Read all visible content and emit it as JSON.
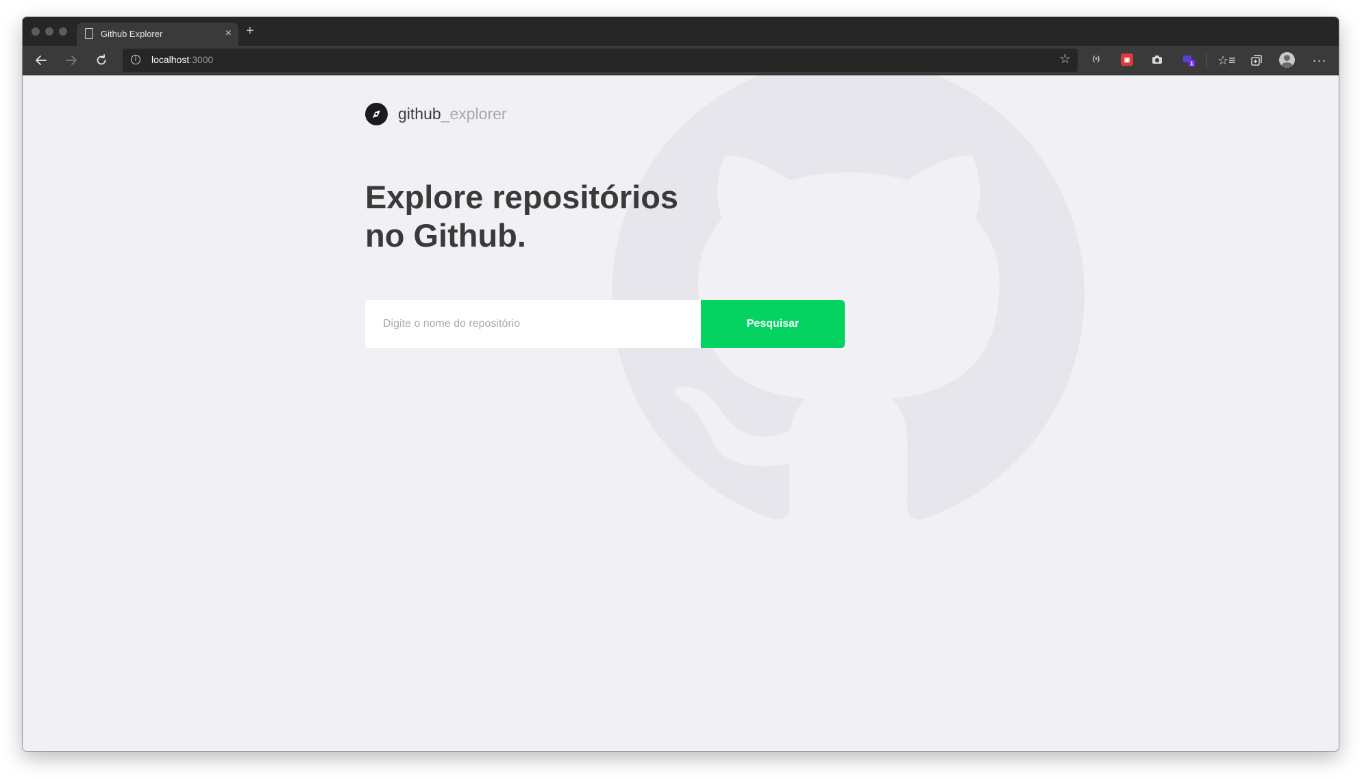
{
  "browser": {
    "tab_title": "Github Explorer",
    "tab_close": "×",
    "new_tab": "+",
    "url_host": "localhost",
    "url_port": ":3000",
    "extension_badge": "1"
  },
  "header": {
    "brand_main": "github",
    "brand_suffix": "_explorer"
  },
  "main": {
    "title_line1": "Explore repositórios",
    "title_line2": "no Github."
  },
  "search": {
    "placeholder": "Digite o nome do repositório",
    "value": "",
    "button_label": "Pesquisar"
  },
  "colors": {
    "background": "#f0f0f5",
    "accent_green": "#04d361",
    "heading": "#3a3a3a",
    "muted": "#a8a8b3"
  }
}
